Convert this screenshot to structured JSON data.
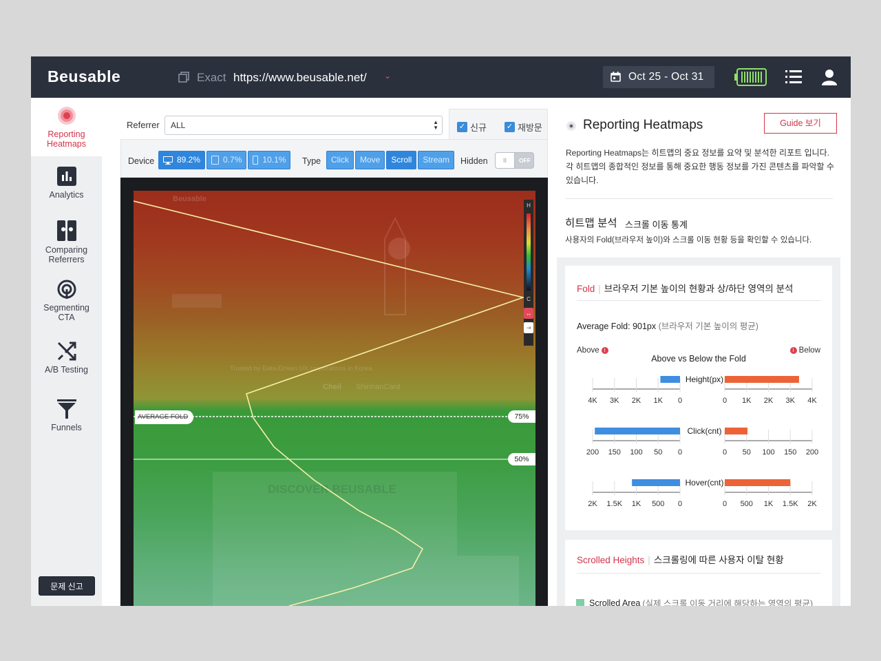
{
  "app": {
    "logo": "Beusable"
  },
  "header": {
    "url_mode": "Exact",
    "url": "https://www.beusable.net/",
    "date_range": "Oct 25 - Oct 31"
  },
  "nav": {
    "items": [
      {
        "label": "Reporting\nHeatmaps",
        "l1": "Reporting",
        "l2": "Heatmaps",
        "active": true,
        "icon": "target-icon"
      },
      {
        "l1": "Analytics",
        "icon": "bar-chart-icon"
      },
      {
        "l1": "Comparing",
        "l2": "Referrers",
        "icon": "compare-icon"
      },
      {
        "l1": "Segmenting",
        "l2": "CTA",
        "icon": "segment-icon"
      },
      {
        "l1": "A/B Testing",
        "icon": "ab-test-icon"
      },
      {
        "l1": "Funnels",
        "icon": "funnel-icon"
      }
    ],
    "report_button": "문제 신고"
  },
  "filters": {
    "referrer_label": "Referrer",
    "referrer_value": "ALL",
    "new_visitor": "신규",
    "return_visitor": "재방문",
    "device_label": "Device",
    "devices": [
      {
        "value": "89.2%",
        "icon": "desktop-icon",
        "selected": true
      },
      {
        "value": "0.7%",
        "icon": "tablet-icon",
        "selected": false
      },
      {
        "value": "10.1%",
        "icon": "mobile-icon",
        "selected": false
      }
    ],
    "type_label": "Type",
    "types": [
      {
        "label": "Click",
        "selected": false
      },
      {
        "label": "Move",
        "selected": false
      },
      {
        "label": "Scroll",
        "selected": true
      },
      {
        "label": "Stream",
        "selected": false
      }
    ],
    "hidden_label": "Hidden",
    "hidden_state": "OFF"
  },
  "heatmap": {
    "legend_high": "H",
    "legend_low": "C",
    "fold_label": "AVERAGE FOLD",
    "pct_75": "75%",
    "pct_50": "50%",
    "bg_texts": {
      "site_logo": "Beusable",
      "partners_line": "Trusted by Data-Driven UX corporations in Korea.",
      "partner_1": "Cheil",
      "partner_2": "ShinhanCard",
      "discover": "DISCOVER BEUSABLE"
    },
    "scroll_curve_note": "Scroll reach curve (data units: % of users at each depth)"
  },
  "report": {
    "title": "Reporting Heatmaps",
    "guide_button": "Guide 보기",
    "description_1": "Reporting Heatmaps는 히트맵의 중요 정보를 요약 및 분석한 리포트 입니다.",
    "description_2": "각 히트맵의 종합적인 정보를 통해 중요한 행동 정보를 가진 콘텐츠를 파악할 수",
    "description_3": "있습니다.",
    "section_title": "히트맵 분석",
    "section_subtitle": "스크롤 이동 통계",
    "section_desc": "사용자의 Fold(브라우저 높이)와 스크롤 이동 현황 등을 확인할 수 있습니다.",
    "fold_card": {
      "title_red": "Fold",
      "title": "브라우저 기본 높이의 현황과 상/하단 영역의 분석",
      "avg_fold": "Average Fold: 901px",
      "avg_fold_note": "(브라우저 기본 높이의 평균)",
      "above_label": "Above",
      "below_label": "Below",
      "chart_title": "Above vs Below the Fold"
    },
    "scroll_card": {
      "title_red": "Scrolled Heights",
      "title": "스크롤링에 따른 사용자 이탈 현황",
      "legend": "Scrolled Area",
      "legend_note": "(실제 스크롤 이동 거리에 해당하는 영역의 평균)"
    }
  },
  "colors": {
    "accent_red": "#d33449",
    "above_blue": "#3f8ee0",
    "below_orange": "#ec6338",
    "topbar": "#2b303d"
  },
  "chart_data": {
    "type": "bar",
    "title": "Above vs Below the Fold",
    "rows": [
      {
        "label": "Height(px)",
        "above": 900,
        "below": 3400,
        "ticks": [
          "4K",
          "3K",
          "2K",
          "1K",
          "0"
        ],
        "ticks_r": [
          "0",
          "1K",
          "2K",
          "3K",
          "4K"
        ],
        "max": 4000
      },
      {
        "label": "Click(cnt)",
        "above": 195,
        "below": 52,
        "ticks": [
          "200",
          "150",
          "100",
          "50",
          "0"
        ],
        "ticks_r": [
          "0",
          "50",
          "100",
          "150",
          "200"
        ],
        "max": 200
      },
      {
        "label": "Hover(cnt)",
        "above": 1100,
        "below": 1500,
        "ticks": [
          "2K",
          "1.5K",
          "1K",
          "500",
          "0"
        ],
        "ticks_r": [
          "0",
          "500",
          "1K",
          "1.5K",
          "2K"
        ],
        "max": 2000
      }
    ],
    "series": [
      {
        "name": "Above"
      },
      {
        "name": "Below"
      }
    ]
  }
}
